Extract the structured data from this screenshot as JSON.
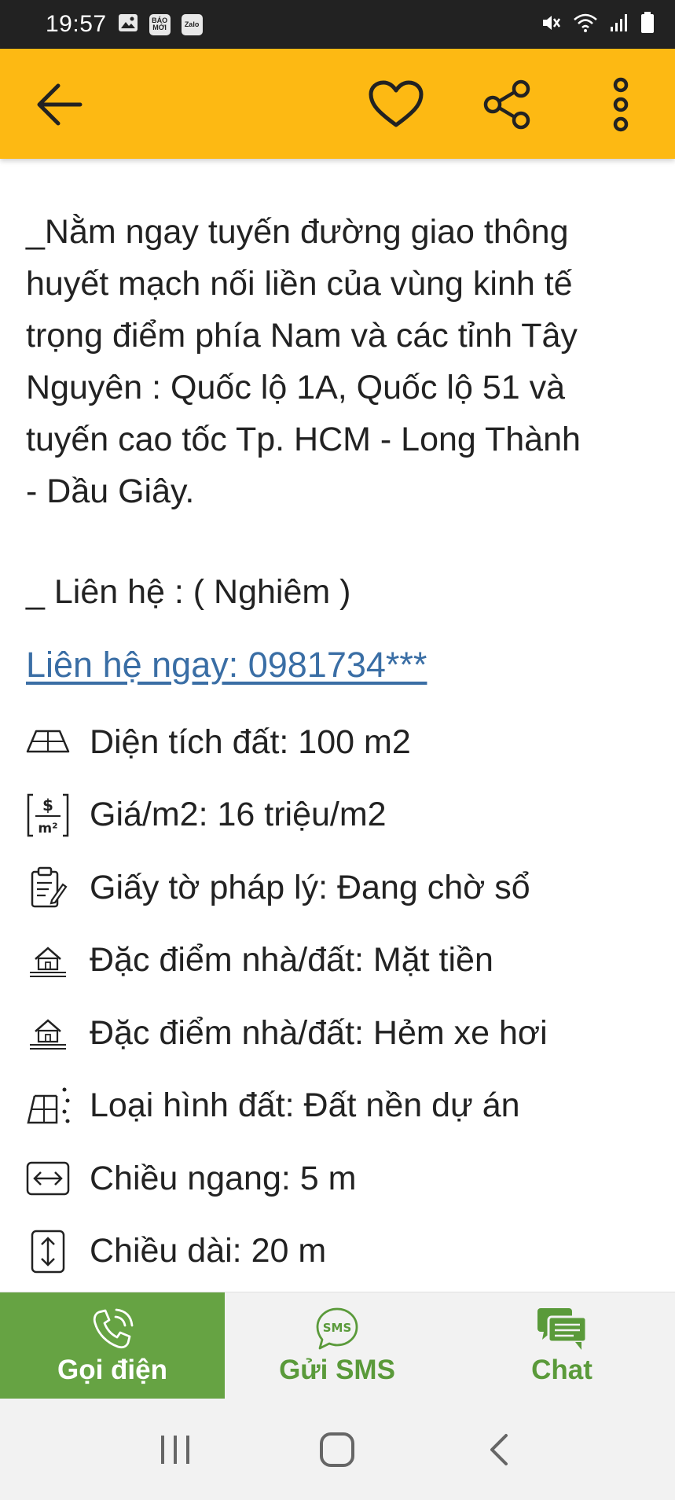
{
  "status_bar": {
    "time": "19:57",
    "badges": [
      "BÁO MỚI",
      "Zalo"
    ],
    "icons": [
      "image-icon",
      "mute-icon",
      "wifi-icon",
      "signal-icon",
      "battery-icon"
    ]
  },
  "app_bar": {
    "icons": [
      "back-arrow-icon",
      "heart-icon",
      "share-icon",
      "more-vert-icon"
    ],
    "background_color": "#fdb913"
  },
  "content": {
    "description": "_Nằm ngay tuyến đường giao thông\nhuyết mạch nối liền của vùng kinh tế\ntrọng điểm phía Nam và các tỉnh Tây\nNguyên : Quốc lộ 1A, Quốc lộ 51 và\ntuyến cao tốc Tp. HCM - Long Thành\n- Dầu Giây.",
    "contact": "_ Liên hệ : ( Nghiêm )",
    "call_link": "Liên hệ ngay: 0981734***"
  },
  "attributes": [
    {
      "icon": "land-area-icon",
      "text": "Diện tích đất: 100 m2"
    },
    {
      "icon": "price-per-m2-icon",
      "text": "Giá/m2: 16 triệu/m2"
    },
    {
      "icon": "document-icon",
      "text": "Giấy tờ pháp lý: Đang chờ sổ"
    },
    {
      "icon": "house-icon",
      "text": "Đặc điểm nhà/đất: Mặt tiền"
    },
    {
      "icon": "house-icon",
      "text": "Đặc điểm nhà/đất: Hẻm xe hơi"
    },
    {
      "icon": "land-type-icon",
      "text": "Loại hình đất: Đất nền dự án"
    },
    {
      "icon": "width-icon",
      "text": "Chiều ngang: 5 m"
    },
    {
      "icon": "length-icon",
      "text": "Chiều dài: 20 m"
    }
  ],
  "action_bar": {
    "call_label": "Gọi điện",
    "sms_label": "Gửi SMS",
    "sms_icon_text": "SMS",
    "chat_label": "Chat",
    "accent_color": "#66a343"
  },
  "nav_bar": {
    "icons": [
      "recent-apps-icon",
      "home-icon",
      "back-icon"
    ]
  }
}
